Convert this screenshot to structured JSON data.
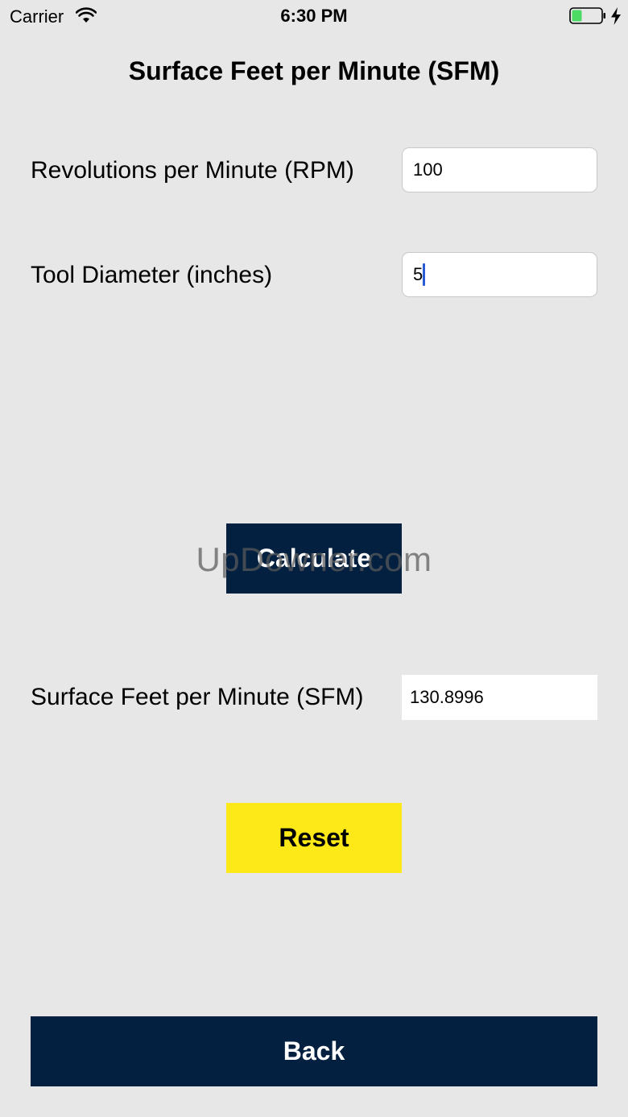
{
  "status_bar": {
    "carrier": "Carrier",
    "time": "6:30 PM",
    "wifi_icon": "wifi-icon",
    "battery_icon": "battery-icon",
    "charging_icon": "charging-bolt-icon",
    "battery_color": "#4cd964"
  },
  "title": "Surface Feet per Minute (SFM)",
  "rpm": {
    "label": "Revolutions per Minute (RPM)",
    "value": "100"
  },
  "diameter": {
    "label": "Tool Diameter (inches)",
    "value": "5"
  },
  "buttons": {
    "calculate": "Calculate",
    "reset": "Reset",
    "back": "Back"
  },
  "result": {
    "label": "Surface Feet per Minute (SFM)",
    "value": "130.8996"
  },
  "watermark": "UpDowner.com",
  "colors": {
    "background": "#e7e7e8",
    "navy": "#042040",
    "yellow": "#fde918"
  }
}
